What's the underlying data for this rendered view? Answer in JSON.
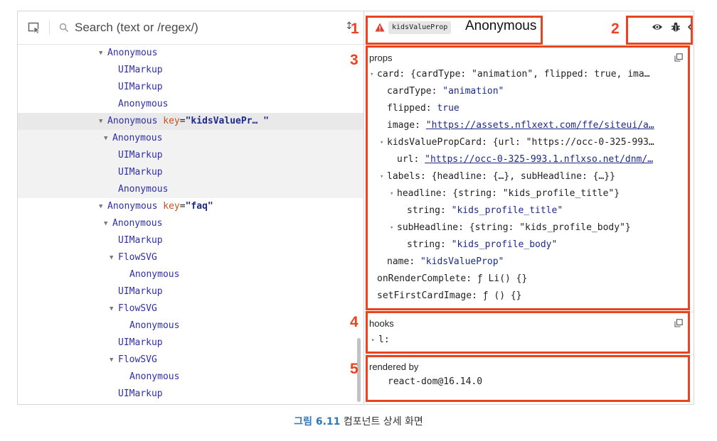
{
  "search": {
    "placeholder": "Search (text or /regex/)"
  },
  "tree": [
    {
      "indent": 14,
      "arrow": true,
      "name": "Anonymous"
    },
    {
      "indent": 16,
      "arrow": false,
      "name": "UIMarkup"
    },
    {
      "indent": 16,
      "arrow": false,
      "name": "UIMarkup"
    },
    {
      "indent": 16,
      "arrow": false,
      "name": "Anonymous"
    },
    {
      "indent": 14,
      "arrow": true,
      "name": "Anonymous",
      "key": "kidsValuePr… ",
      "state": "selected"
    },
    {
      "indent": 15,
      "arrow": true,
      "name": "Anonymous",
      "state": "sub"
    },
    {
      "indent": 16,
      "arrow": false,
      "name": "UIMarkup",
      "state": "sub"
    },
    {
      "indent": 16,
      "arrow": false,
      "name": "UIMarkup",
      "state": "sub"
    },
    {
      "indent": 16,
      "arrow": false,
      "name": "Anonymous",
      "state": "sub"
    },
    {
      "indent": 14,
      "arrow": true,
      "name": "Anonymous",
      "key": "faq"
    },
    {
      "indent": 15,
      "arrow": true,
      "name": "Anonymous"
    },
    {
      "indent": 16,
      "arrow": false,
      "name": "UIMarkup"
    },
    {
      "indent": 16,
      "arrow": true,
      "name": "FlowSVG"
    },
    {
      "indent": 18,
      "arrow": false,
      "name": "Anonymous"
    },
    {
      "indent": 16,
      "arrow": false,
      "name": "UIMarkup"
    },
    {
      "indent": 16,
      "arrow": true,
      "name": "FlowSVG"
    },
    {
      "indent": 18,
      "arrow": false,
      "name": "Anonymous"
    },
    {
      "indent": 16,
      "arrow": false,
      "name": "UIMarkup"
    },
    {
      "indent": 16,
      "arrow": true,
      "name": "FlowSVG"
    },
    {
      "indent": 18,
      "arrow": false,
      "name": "Anonymous"
    },
    {
      "indent": 16,
      "arrow": false,
      "name": "UIMarkup"
    }
  ],
  "tree_key_label": "key",
  "header": {
    "key_badge": "kidsValueProp",
    "component_name": "Anonymous",
    "icons": [
      "eye-icon",
      "bug-icon",
      "code-icon"
    ]
  },
  "props": {
    "title": "props",
    "rows": [
      {
        "indent": 0,
        "arrow": true,
        "key": "card",
        "value": "{cardType: \"animation\", flipped: true, ima…",
        "type": "plain"
      },
      {
        "indent": 1,
        "arrow": false,
        "key": "cardType",
        "value": "\"animation\"",
        "type": "string"
      },
      {
        "indent": 1,
        "arrow": false,
        "key": "flipped",
        "value": "true",
        "type": "string"
      },
      {
        "indent": 1,
        "arrow": false,
        "key": "image",
        "value": "\"https://assets.nflxext.com/ffe/siteui/a…",
        "type": "link"
      },
      {
        "indent": 1,
        "arrow": true,
        "key": "kidsValuePropCard",
        "value": "{url: \"https://occ-0-325-993…",
        "type": "plain"
      },
      {
        "indent": 2,
        "arrow": false,
        "key": "url",
        "value": "\"https://occ-0-325-993.1.nflxso.net/dnm/…",
        "type": "link"
      },
      {
        "indent": 1,
        "arrow": true,
        "key": "labels",
        "value": "{headline: {…}, subHeadline: {…}}",
        "type": "plain"
      },
      {
        "indent": 2,
        "arrow": true,
        "key": "headline",
        "value": "{string: \"kids_profile_title\"}",
        "type": "plain"
      },
      {
        "indent": 3,
        "arrow": false,
        "key": "string",
        "value": "\"kids_profile_title\"",
        "type": "string"
      },
      {
        "indent": 2,
        "arrow": true,
        "key": "subHeadline",
        "value": "{string: \"kids_profile_body\"}",
        "type": "plain"
      },
      {
        "indent": 3,
        "arrow": false,
        "key": "string",
        "value": "\"kids_profile_body\"",
        "type": "string"
      },
      {
        "indent": 1,
        "arrow": false,
        "key": "name",
        "value": "\"kidsValueProp\"",
        "type": "string"
      },
      {
        "indent": 0,
        "arrow": false,
        "key": "onRenderComplete",
        "value": "ƒ Li() {}",
        "type": "plain"
      },
      {
        "indent": 0,
        "arrow": false,
        "key": "setFirstCardImage",
        "value": "ƒ () {}",
        "type": "plain"
      }
    ]
  },
  "hooks": {
    "title": "hooks",
    "items": [
      {
        "key": "l",
        "text": "l:"
      }
    ]
  },
  "rendered_by": {
    "title": "rendered by",
    "value": "react-dom@16.14.0"
  },
  "annotations": [
    "1",
    "2",
    "3",
    "4",
    "5"
  ],
  "caption": {
    "label": "그림 6.11",
    "text": " 컴포넌트 상세 화면"
  },
  "colors": {
    "annotation": "#e8441f",
    "component": "#2f2fa8",
    "key_name": "#c4521c",
    "string": "#1c2a8a",
    "caption_label": "#2e77b8"
  }
}
